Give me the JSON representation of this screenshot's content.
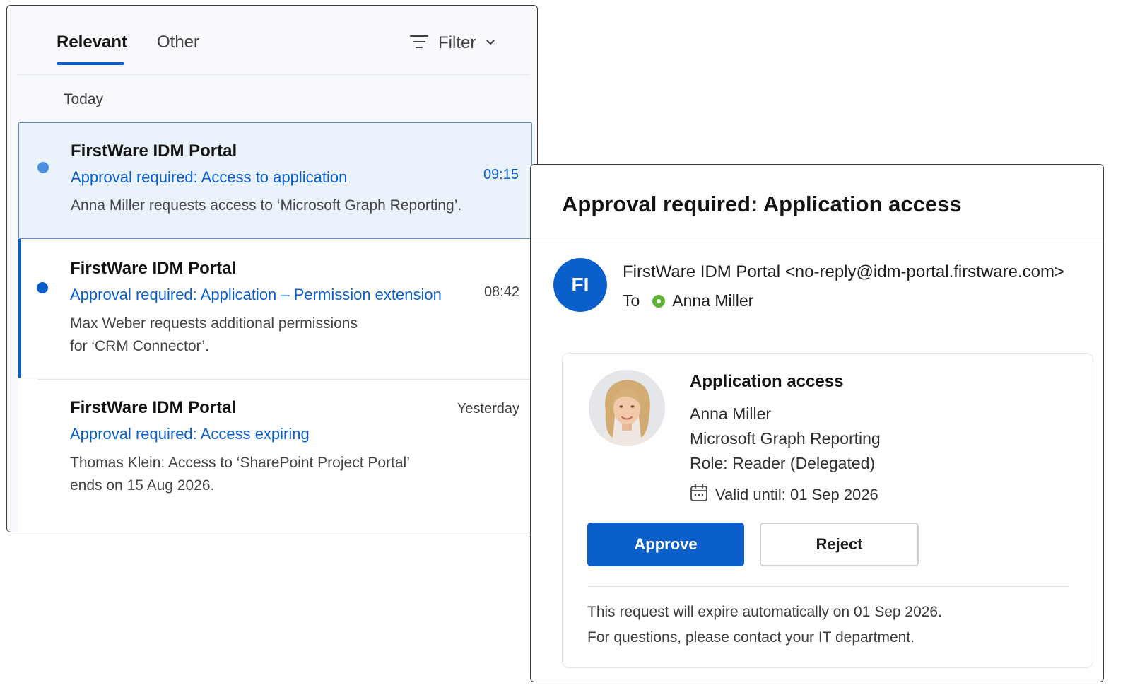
{
  "inbox": {
    "tabs": {
      "relevant": "Relevant",
      "other": "Other"
    },
    "filter_label": "Filter",
    "group_label": "Today",
    "messages": [
      {
        "sender": "FirstWare IDM Portal",
        "subject": "Approval required: Access to application",
        "time": "09:15",
        "preview": "Anna Miller requests access to ‘Microsoft Graph Reporting’.",
        "unread": true
      },
      {
        "sender": "FirstWare IDM Portal",
        "subject": "Approval required: Application – Permission extension",
        "time": "08:42",
        "preview_line1": "Max Weber requests additional permissions",
        "preview_line2": "for ‘CRM Connector’.",
        "unread": true
      },
      {
        "sender": "FirstWare IDM Portal",
        "subject": "Approval required: Access expiring",
        "time": "Yesterday",
        "preview_line1": "Thomas Klein: Access to ‘SharePoint Project Portal’",
        "preview_line2": "ends on 15 Aug 2026.",
        "unread": false
      }
    ]
  },
  "reader": {
    "title": "Approval required: Application access",
    "sender_initials": "FI",
    "from": "FirstWare IDM Portal <no-reply@idm-portal.firstware.com>",
    "to_label": "To",
    "to_name": "Anna Miller",
    "card": {
      "title": "Application access",
      "requester": "Anna Miller",
      "application": "Microsoft Graph Reporting",
      "role": "Role: Reader (Delegated)",
      "valid_until": "Valid until: 01 Sep 2026",
      "approve_label": "Approve",
      "reject_label": "Reject",
      "footer_line1": "This request will expire automatically on 01 Sep 2026.",
      "footer_line2": "For questions, please contact your IT department."
    }
  },
  "colors": {
    "accent": "#0a5fcb",
    "selected_bg": "#eaf2fc",
    "unread_dot_selected": "#4a8fe0",
    "presence_available": "#5cb531"
  }
}
